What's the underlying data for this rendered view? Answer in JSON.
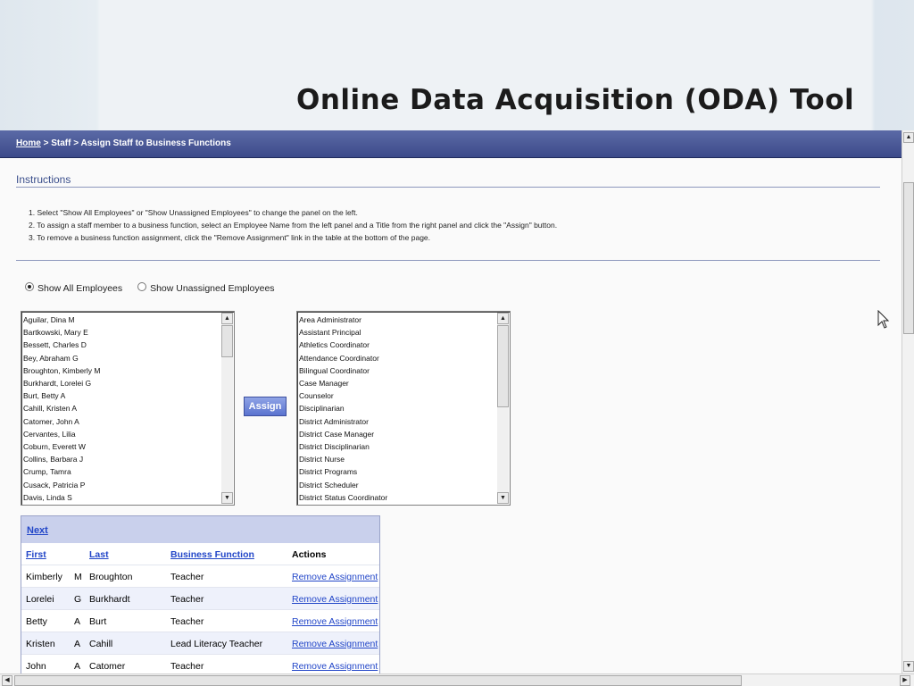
{
  "slide": {
    "title": "Online Data Acquisition (ODA) Tool"
  },
  "breadcrumb": {
    "home": "Home",
    "sep1": " > ",
    "staff": "Staff",
    "sep2": " > ",
    "current": "Assign Staff to Business Functions"
  },
  "instructions": {
    "heading": "Instructions",
    "steps": [
      "1.   Select \"Show All Employees\" or \"Show Unassigned Employees\" to change the panel on the left.",
      "2.   To assign a staff member to a business function, select an Employee Name from the left panel and a Title from the right panel and click the \"Assign\" button.",
      "3.   To remove a business function assignment, click the \"Remove Assignment\" link in the table at the bottom of the page."
    ]
  },
  "filter": {
    "options": [
      "Show All Employees",
      "Show Unassigned Employees"
    ],
    "selected": "Show All Employees"
  },
  "employees": [
    "Aguilar, Dina M",
    "Bartkowski, Mary E",
    "Bessett, Charles D",
    "Bey, Abraham G",
    "Broughton, Kimberly M",
    "Burkhardt, Lorelei G",
    "Burt, Betty A",
    "Cahill, Kristen A",
    "Catomer, John A",
    "Cervantes, Lilia",
    "Coburn, Everett W",
    "Collins, Barbara J",
    "Crump, Tamra",
    "Cusack, Patricia P",
    "Davis, Linda S"
  ],
  "titles": [
    "Area Administrator",
    "Assistant Principal",
    "Athletics Coordinator",
    "Attendance Coordinator",
    "Bilingual Coordinator",
    "Case Manager",
    "Counselor",
    "Disciplinarian",
    "District Administrator",
    "District Case Manager",
    "District Disciplinarian",
    "District Nurse",
    "District Programs",
    "District Scheduler",
    "District Status Coordinator"
  ],
  "assign_button": "Assign",
  "table": {
    "next": "Next",
    "headers": {
      "first": "First",
      "last": "Last",
      "function": "Business Function",
      "actions": "Actions"
    },
    "rows": [
      {
        "first": "Kimberly",
        "mi": "M",
        "last": "Broughton",
        "function": "Teacher",
        "action": "Remove Assignment"
      },
      {
        "first": "Lorelei",
        "mi": "G",
        "last": "Burkhardt",
        "function": "Teacher",
        "action": "Remove Assignment"
      },
      {
        "first": "Betty",
        "mi": "A",
        "last": "Burt",
        "function": "Teacher",
        "action": "Remove Assignment"
      },
      {
        "first": "Kristen",
        "mi": "A",
        "last": "Cahill",
        "function": "Lead Literacy Teacher",
        "action": "Remove Assignment"
      },
      {
        "first": "John",
        "mi": "A",
        "last": "Catomer",
        "function": "Teacher",
        "action": "Remove Assignment"
      }
    ]
  },
  "icons": {
    "scroll_up": "▲",
    "scroll_down": "▼",
    "scroll_left": "◀",
    "scroll_right": "▶",
    "cursor": "mouse-pointer"
  },
  "colors": {
    "nav_bar": "#3c4a8a",
    "heading": "#3b4f8c",
    "link": "#2246c8",
    "button": "#5a73cf"
  }
}
